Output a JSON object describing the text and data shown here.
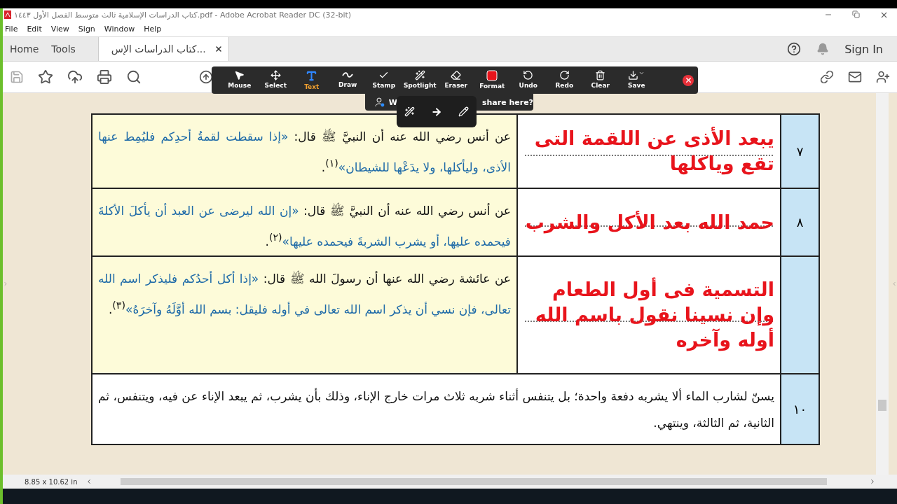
{
  "window": {
    "title": "كتاب الدراسات الإسلامية ثالث متوسط الفصل الأول ١٤٤٣.pdf - Adobe Acrobat Reader DC (32-bit)"
  },
  "menu": [
    "Help",
    "Window",
    "Sign",
    "View",
    "Edit",
    "File"
  ],
  "tabs": [
    {
      "label": "كتاب الدراسات الإس...",
      "selected": true,
      "closable": true
    },
    {
      "label": "Tools",
      "selected": false,
      "closable": false
    },
    {
      "label": "Home",
      "selected": false,
      "closable": false
    }
  ],
  "sign_in": "Sign In",
  "zoom_toolbar": {
    "tools": [
      {
        "kind": "save",
        "label": "Save",
        "selected": false
      },
      {
        "kind": "clear",
        "label": "Clear",
        "selected": false
      },
      {
        "kind": "redo",
        "label": "Redo",
        "selected": false
      },
      {
        "kind": "undo",
        "label": "Undo",
        "selected": false
      },
      {
        "kind": "format",
        "label": "Format",
        "selected": false
      },
      {
        "kind": "eraser",
        "label": "Eraser",
        "selected": false
      },
      {
        "kind": "spotlight",
        "label": "Spotlight",
        "selected": false
      },
      {
        "kind": "stamp",
        "label": "Stamp",
        "selected": false
      },
      {
        "kind": "draw",
        "label": "Draw",
        "selected": false
      },
      {
        "kind": "text",
        "label": "Text",
        "selected": true
      },
      {
        "kind": "select",
        "label": "Select",
        "selected": false
      },
      {
        "kind": "mouse",
        "label": "Mouse",
        "selected": false
      }
    ]
  },
  "share_banner": {
    "text_start": "W",
    "text_end": "share here?"
  },
  "table": {
    "rows": [
      {
        "number": "٧",
        "highlighted": true,
        "title": "يبعد الأذى عن اللقمة التى تقع وياكلها",
        "text": [
          {
            "kind": "narrator",
            "text": "عن أنس رضي الله عنه أن النبيَّ ﷺ قال: "
          },
          {
            "kind": "hadith",
            "text": "«إذا سقطت لقمةُ أحدِكم فليُمِط عنها الأذى، وليأكلها، ولا يدَعْها للشيطان»"
          },
          {
            "kind": "narrator",
            "text": "$^{(١)}$."
          }
        ]
      },
      {
        "number": "٨",
        "highlighted": true,
        "title": "حمد الله بعد الأكل والشرب",
        "text": [
          {
            "kind": "narrator",
            "text": "عن أنس رضي الله عنه أن النبيَّ ﷺ قال: "
          },
          {
            "kind": "hadith",
            "text": "«إن الله ليرضى عن العبد أن يأكلَ الأكلةَ فيحمده عليها، أو يشرب الشربةَ فيحمده عليها»"
          },
          {
            "kind": "narrator",
            "text": "$^{(٢)}$."
          }
        ]
      },
      {
        "highlighted": true,
        "title": "التسمية فى أول الطعام وإن نسينا نقول باسم الله أوله وآخره",
        "text": [
          {
            "kind": "narrator",
            "text": "عن عائشة رضي الله عنها أن رسولَ الله ﷺ قال: "
          },
          {
            "kind": "hadith",
            "text": "«إذا أكل أحدُكم فليذكر اسم الله تعالى، فإن نسي أن يذكر اسم الله تعالى في أوله فليقل: بسم الله أوَّلَهُ وآخرَهُ»"
          },
          {
            "kind": "narrator",
            "text": "$^{(٣)}$."
          }
        ]
      },
      {
        "number": "١٠",
        "highlighted": false,
        "text": [
          {
            "kind": "narrator",
            "text": "يسنّ لشارب الماء ألا يشربه دفعة واحدة؛ بل يتنفس أثناء شربه ثلاث مرات خارج الإناء، وذلك بأن يشرب، ثم يبعد الإناء عن فيه، ويتنفس، ثم الثانية، ثم الثالثة، وينتهي."
          }
        ]
      }
    ]
  },
  "status_bar": {
    "page_size": "8.85 x 10.62 in"
  }
}
